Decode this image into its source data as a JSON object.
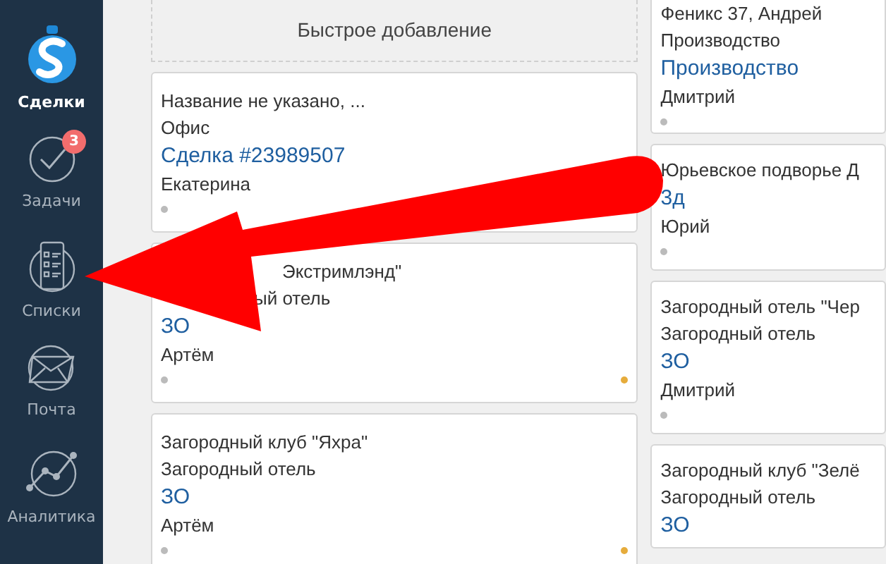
{
  "sidebar": {
    "items": [
      {
        "label": "Сделки",
        "selected": true
      },
      {
        "label": "Задачи",
        "selected": false,
        "badge": "3"
      },
      {
        "label": "Списки",
        "selected": false
      },
      {
        "label": "Почта",
        "selected": false
      },
      {
        "label": "Аналитика",
        "selected": false
      }
    ]
  },
  "columns": [
    {
      "quick_add": "Быстрое добавление",
      "cards": [
        {
          "kind": "full",
          "lines": [
            "Название не указано, ...",
            "Офис"
          ],
          "link": "Сделка #23989507",
          "owner": "Екатерина",
          "flagged": false
        },
        {
          "kind": "covered",
          "lines": [
            "Экстримлэнд\"",
            "ый отель"
          ],
          "link": "ЗО",
          "owner": "Артём",
          "flagged": true
        },
        {
          "kind": "full",
          "lines": [
            "Загородный клуб \"Яхра\"",
            "Загородный отель"
          ],
          "link": "ЗО",
          "owner": "Артём",
          "flagged": true
        }
      ]
    },
    {
      "cards": [
        {
          "kind": "top_cut",
          "lines": [
            "Феникс 37, Андрей",
            "Производство"
          ],
          "link": "Производство",
          "owner": "Дмитрий",
          "flagged": false
        },
        {
          "kind": "full",
          "lines": [
            "Юрьевское подворье Д"
          ],
          "link": "3д",
          "owner": "Юрий",
          "flagged": false
        },
        {
          "kind": "full",
          "lines": [
            "Загородный отель \"Чер",
            "Загородный отель"
          ],
          "link": "ЗО",
          "owner": "Дмитрий",
          "flagged": false
        },
        {
          "kind": "full",
          "lines": [
            "Загородный клуб \"Зелё",
            "Загородный отель"
          ],
          "link": "ЗО",
          "flagged": false
        }
      ]
    }
  ]
}
